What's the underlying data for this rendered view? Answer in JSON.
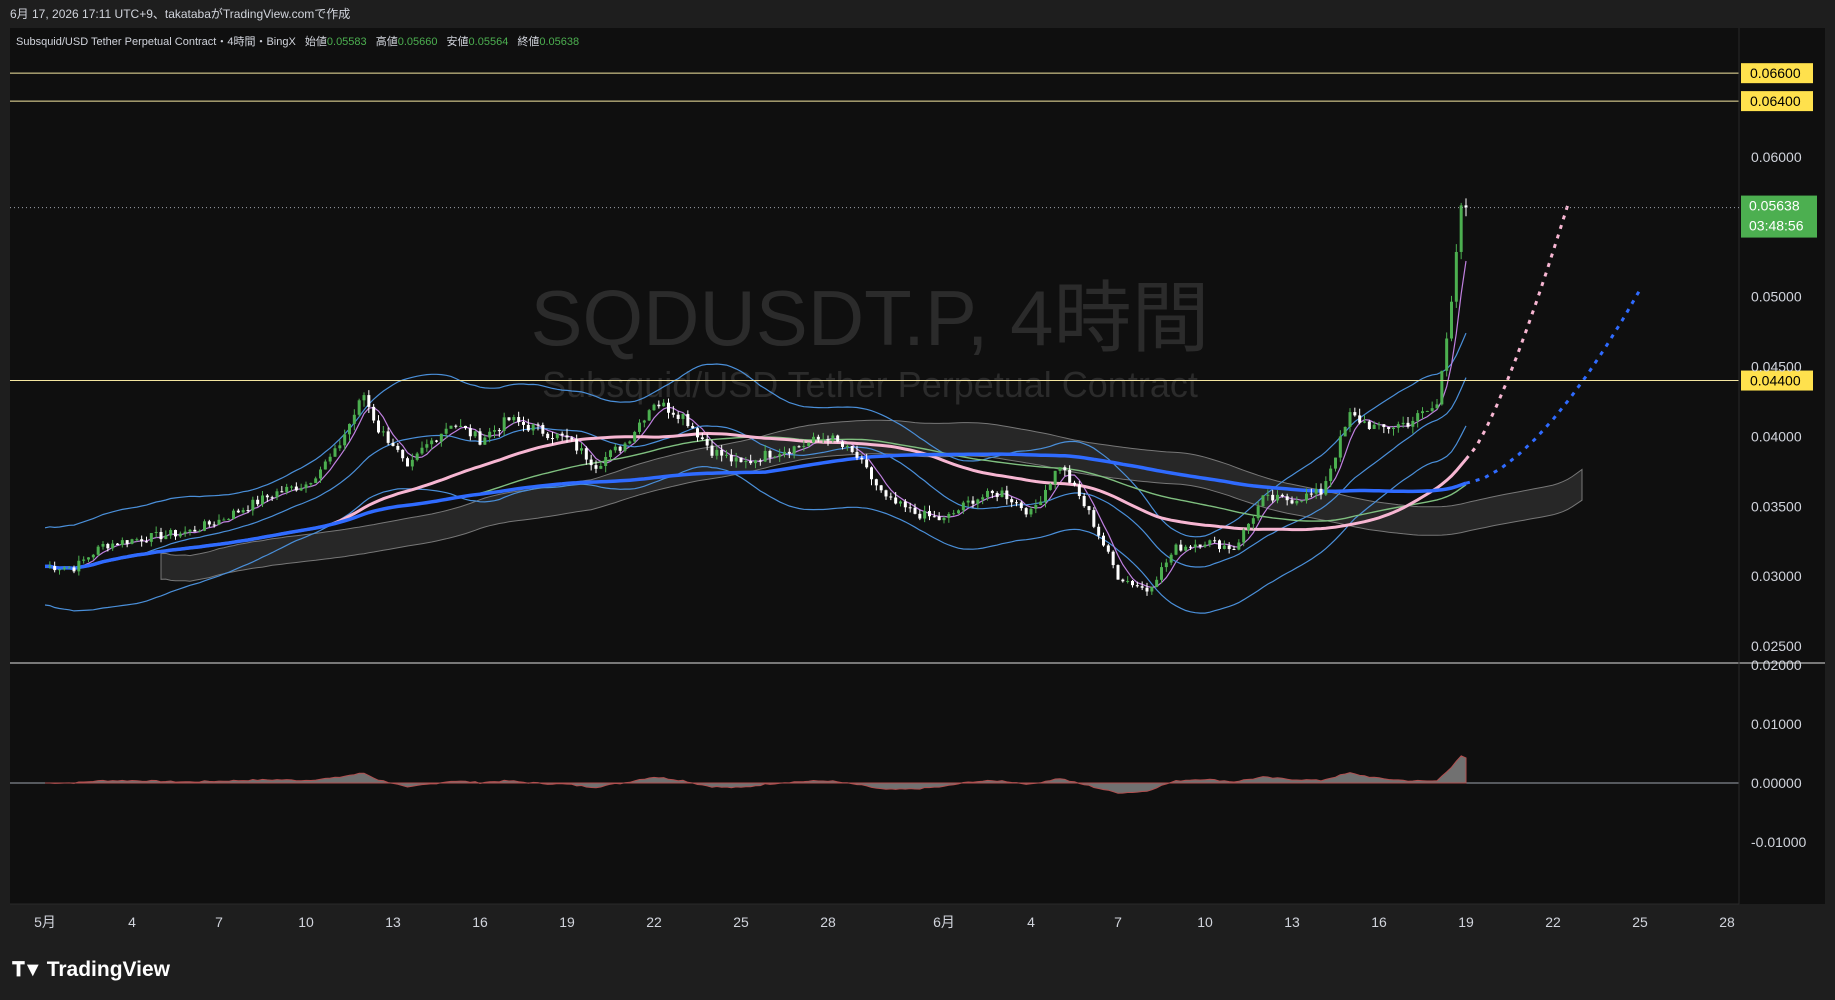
{
  "header": {
    "timestamp_line": "6月 17, 2026 17:11 UTC+9、takatabaがTradingView.comで作成"
  },
  "legend": {
    "symbol_desc": "Subsquid/USD Tether Perpetual Contract・4時間・BingX",
    "open_label": "始値",
    "open_value": "0.05583",
    "high_label": "高値",
    "high_value": "0.05660",
    "low_label": "安値",
    "low_value": "0.05564",
    "close_label": "終値",
    "close_value": "0.05638"
  },
  "watermark": {
    "symbol": "SQDUSDT.P, 4時間",
    "description": "Subsquid/USD Tether Perpetual Contract"
  },
  "price_axis": {
    "labels": [
      "0.06000",
      "0.05500",
      "0.05000",
      "0.04500",
      "0.04000",
      "0.03500",
      "0.03000",
      "0.02500"
    ],
    "last_price": "0.05638",
    "countdown": "03:48:56",
    "last_price_color": "#4caf50"
  },
  "oscillator_axis": {
    "labels": [
      "0.02000",
      "0.01000",
      "0.00000",
      "-0.01000"
    ]
  },
  "time_axis": {
    "labels": [
      "5月",
      "4",
      "7",
      "10",
      "13",
      "16",
      "19",
      "22",
      "25",
      "28",
      "6月",
      "4",
      "7",
      "10",
      "13",
      "16",
      "19",
      "22",
      "25",
      "28"
    ]
  },
  "horizontal_lines": [
    {
      "price": 0.066,
      "label": "0.06600"
    },
    {
      "price": 0.064,
      "label": "0.06400"
    },
    {
      "price": 0.044,
      "label": "0.04400"
    }
  ],
  "colors": {
    "background": "#0f0f0f",
    "up_candle": "#4caf50",
    "down_candle": "#ffffff",
    "hline": "#f5e6a0",
    "sma_blue": "#2f6bff",
    "ema_pink": "#f7b6d2",
    "bb": "#4a8fd9",
    "green_ma": "#7fbf7f",
    "purple": "#c080e0",
    "cloud": "#444444"
  },
  "footer": {
    "brand": "TradingView"
  },
  "chart_data": {
    "type": "line",
    "title": "SQDUSDT.P, 4時間",
    "x": [
      "5月",
      "4",
      "7",
      "10",
      "13",
      "16",
      "19",
      "22",
      "25",
      "28",
      "6月",
      "4",
      "7",
      "10",
      "13",
      "16"
    ],
    "series": [
      {
        "name": "",
        "values": [
          0.0305,
          0.0325,
          0.034,
          0.0365,
          0.0425,
          0.0395,
          0.0405,
          0.0385,
          0.038,
          0.0395,
          0.034,
          0.0365,
          0.0305,
          0.0335,
          0.0405,
          0.0415
        ]
      }
    ],
    "last_close": 0.05638,
    "ylim": [
      0.023,
      0.068
    ],
    "grid": false
  }
}
